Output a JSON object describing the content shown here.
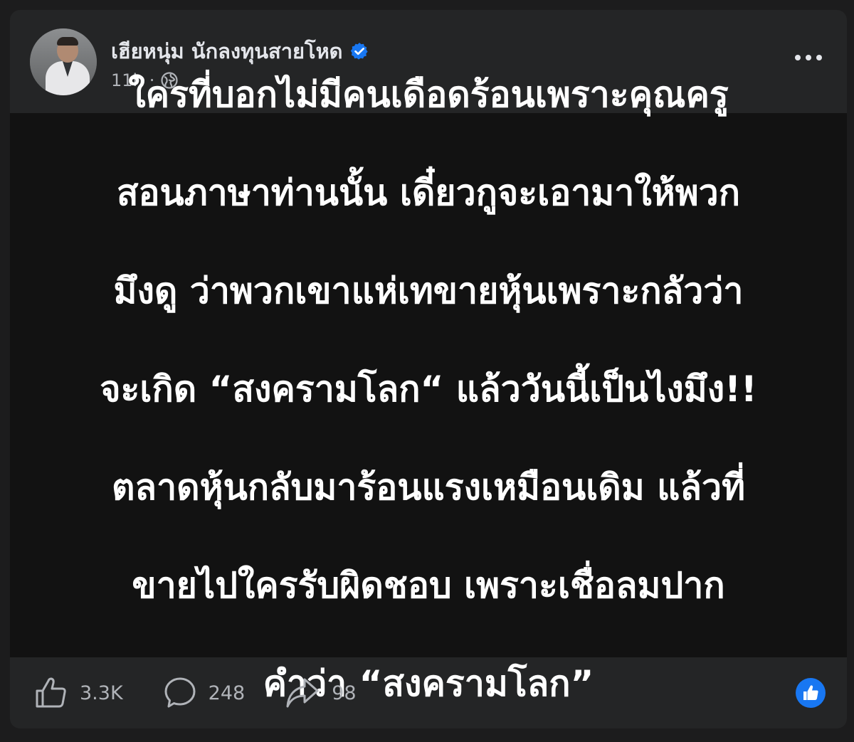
{
  "post": {
    "author": {
      "name": "เฮียหนุ่ม นักลงทุนสายโหด",
      "verified": true,
      "avatar_icon": "profile-photo"
    },
    "time": "11h",
    "separator": "·",
    "audience_icon": "globe-icon",
    "more_icon": "more-options-icon",
    "body_lines": [
      "ใครที่บอกไม่มีคนเดือดร้อนเพราะคุณครู",
      "สอนภาษาท่านนั้น เดี๋ยวกูจะเอามาให้พวก",
      "มึงดู ว่าพวกเขาแห่เทขายหุ้นเพราะกลัวว่า",
      "จะเกิด “สงครามโลก“ แล้ววันนี้เป็นไงมึง!!",
      "ตลาดหุ้นกลับมาร้อนแรงเหมือนเดิม แล้วที่",
      "ขายไปใครรับผิดชอบ เพราะเชื่อลมปาก",
      "คำว่า “สงครามโลก”"
    ]
  },
  "footer": {
    "likes": "3.3K",
    "comments": "248",
    "shares": "98",
    "reaction_icon": "like-reaction-icon"
  },
  "colors": {
    "card_bg": "#242526",
    "body_bg": "#121212",
    "text_primary": "#e4e6eb",
    "text_secondary": "#b0b3b8",
    "accent_blue": "#1877f2"
  }
}
